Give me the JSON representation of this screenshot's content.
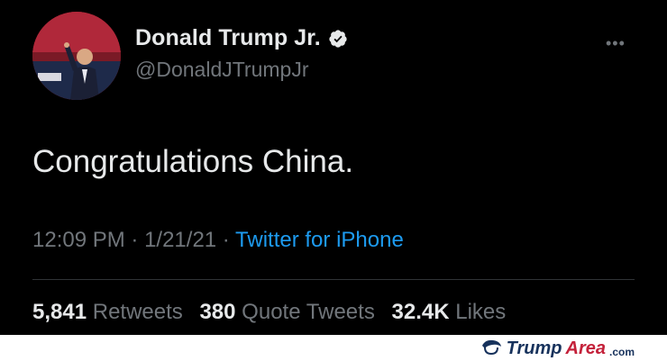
{
  "tweet": {
    "author_name": "Donald Trump Jr.",
    "handle": "@DonaldJTrumpJr",
    "more_label": "•••",
    "text": "Congratulations China.",
    "time": "12:09 PM",
    "date": "1/21/21",
    "separator": " · ",
    "source": "Twitter for iPhone",
    "stats": {
      "retweets_count": "5,841",
      "retweets_label": "Retweets",
      "quotes_count": "380",
      "quotes_label": "Quote Tweets",
      "likes_count": "32.4K",
      "likes_label": "Likes"
    }
  },
  "watermark": {
    "part1": "Trump",
    "part2": "Area",
    "part3": ".com"
  },
  "icons": {
    "verified": "verified-badge-icon",
    "more": "more-options-icon",
    "watermark_logo": "trump-hair-logo-icon"
  },
  "colors": {
    "background": "#000000",
    "text_primary": "#e7e9ea",
    "text_secondary": "#71767b",
    "link": "#1d9bf0",
    "watermark_blue": "#17325c",
    "watermark_red": "#c4213a"
  }
}
